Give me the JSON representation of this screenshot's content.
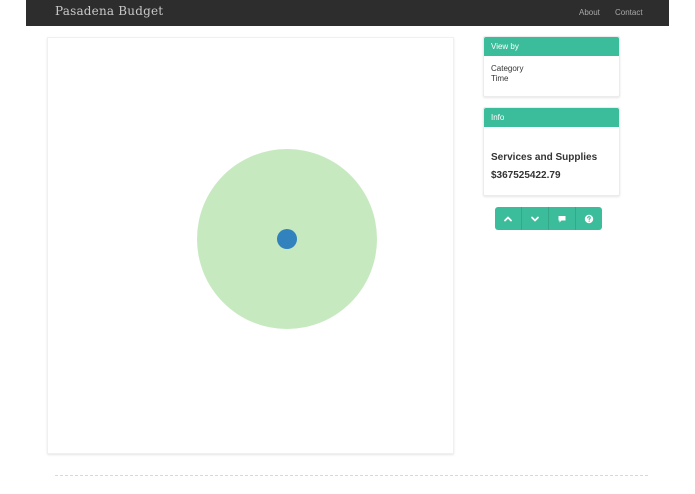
{
  "navbar": {
    "brand": "Pasadena Budget",
    "links": [
      {
        "label": "About"
      },
      {
        "label": "Contact"
      }
    ]
  },
  "visualization": {
    "outer_circle_color": "#c7e9c0",
    "inner_circle_color": "#3182bd"
  },
  "view_by": {
    "title": "View by",
    "options": [
      "Category",
      "Time"
    ]
  },
  "info": {
    "title": "Info",
    "name": "Services and Supplies",
    "amount": "$367525422.79"
  },
  "controls": {
    "buttons": [
      {
        "icon": "chevron-up-icon"
      },
      {
        "icon": "chevron-down-icon"
      },
      {
        "icon": "comment-icon"
      },
      {
        "icon": "question-icon"
      }
    ]
  },
  "colors": {
    "accent": "#3bbd9b",
    "navbar": "#2d2d2d"
  }
}
